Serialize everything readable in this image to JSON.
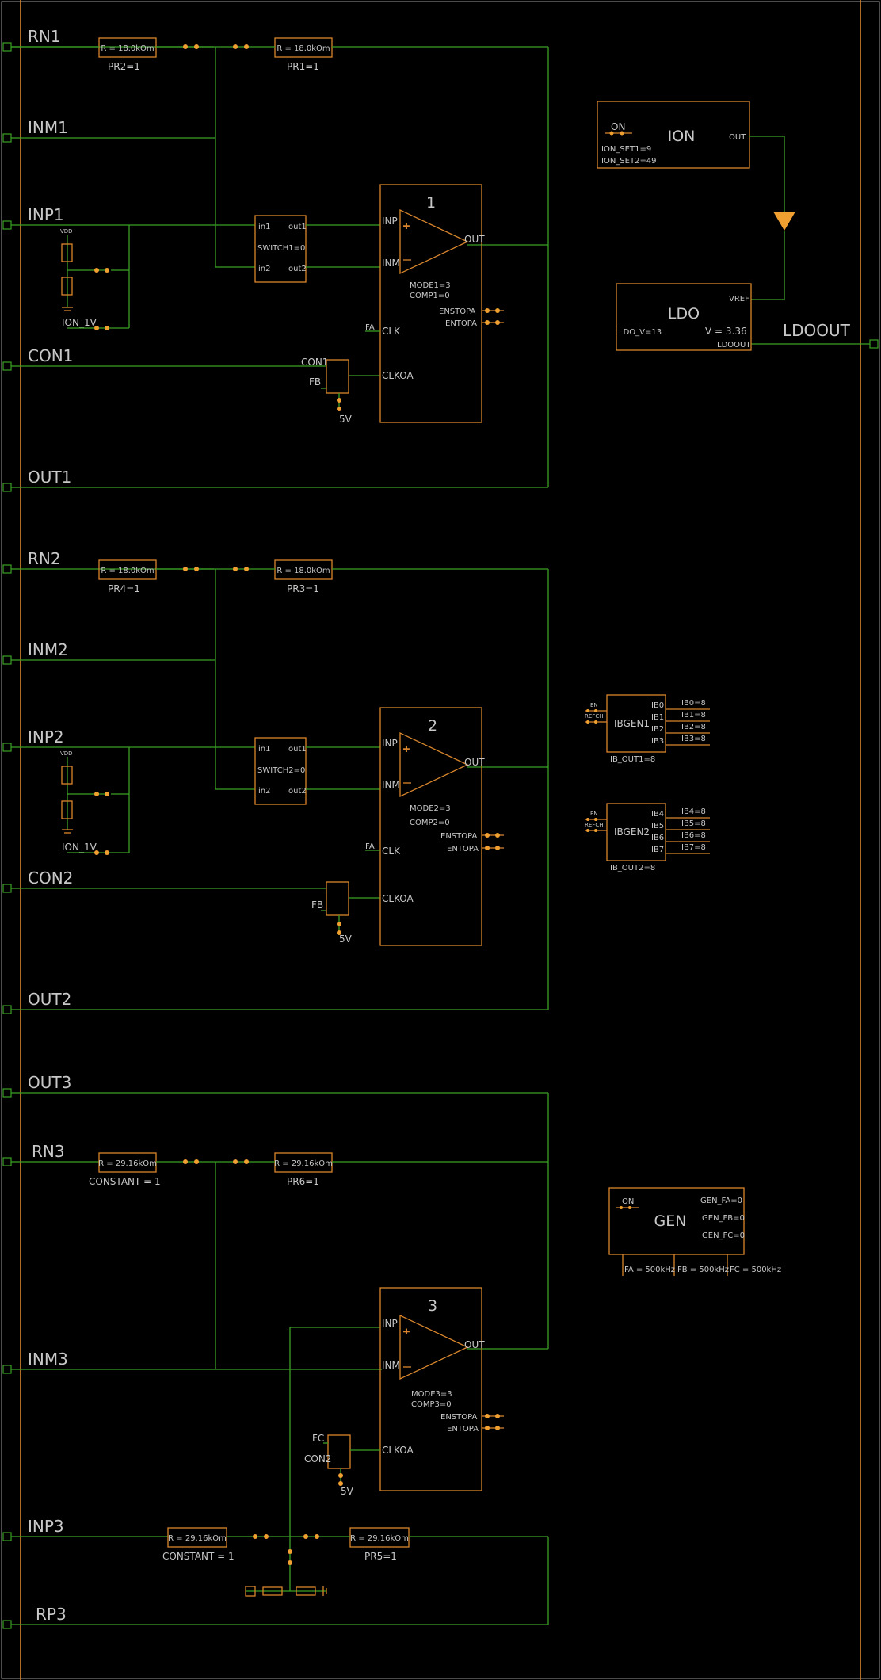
{
  "ports": {
    "rn1": "RN1",
    "inm1": "INM1",
    "inp1": "INP1",
    "con1": "CON1",
    "out1": "OUT1",
    "rn2": "RN2",
    "inm2": "INM2",
    "inp2": "INP2",
    "con2": "CON2",
    "out2": "OUT2",
    "out3": "OUT3",
    "rn3": "RN3",
    "inm3": "INM3",
    "inp3": "INP3",
    "rp3": "RP3",
    "ldoout": "LDOOUT"
  },
  "resistors": {
    "r1a_value": "R = 18.0kOm",
    "r1a_label": "PR2=1",
    "r1b_value": "R = 18.0kOm",
    "r1b_label": "PR1=1",
    "r2a_value": "R = 18.0kOm",
    "r2a_label": "PR4=1",
    "r2b_value": "R = 18.0kOm",
    "r2b_label": "PR3=1",
    "r3a_value": "R = 29.16kOm",
    "r3a_label": "CONSTANT = 1",
    "r3b_value": "R = 29.16kOm",
    "r3b_label": "PR6=1",
    "r4a_value": "R = 29.16kOm",
    "r4a_label": "CONSTANT = 1",
    "r4b_value": "R = 29.16kOm",
    "r4b_label": "PR5=1"
  },
  "amp1": {
    "num": "1",
    "inp": "INP",
    "inm": "INM",
    "out": "OUT",
    "mode": "MODE1=3",
    "comp": "COMP1=0",
    "enstopa": "ENSTOPA",
    "entopa": "ENTOPA",
    "clk": "CLK",
    "clkoa": "CLKOA",
    "fa": "FA"
  },
  "amp2": {
    "num": "2",
    "inp": "INP",
    "inm": "INM",
    "out": "OUT",
    "mode": "MODE2=3",
    "comp": "COMP2=0",
    "enstopa": "ENSTOPA",
    "entopa": "ENTOPA",
    "clk": "CLK",
    "clkoa": "CLKOA",
    "fa": "FA"
  },
  "amp3": {
    "num": "3",
    "inp": "INP",
    "inm": "INM",
    "out": "OUT",
    "mode": "MODE3=3",
    "comp": "COMP3=0",
    "enstopa": "ENSTOPA",
    "entopa": "ENTOPA",
    "clkoa": "CLKOA"
  },
  "switch1": {
    "in1": "in1",
    "in2": "in2",
    "out1": "out1",
    "out2": "out2",
    "label": "SWITCH1=0"
  },
  "switch2": {
    "in1": "in1",
    "in2": "in2",
    "out1": "out1",
    "out2": "out2",
    "label": "SWITCH2=0"
  },
  "divider1": {
    "vdd": "VDD",
    "ion": "ION_1V"
  },
  "divider2": {
    "vdd": "VDD",
    "ion": "ION_1V"
  },
  "mux1": {
    "con": "CON1",
    "fb": "FB",
    "v5": "5V"
  },
  "mux2": {
    "fb": "FB",
    "v5": "5V"
  },
  "mux3": {
    "fc": "FC",
    "con": "CON2",
    "v5": "5V"
  },
  "ion": {
    "title": "ION",
    "on": "ON",
    "set1": "ION_SET1=9",
    "set2": "ION_SET2=49",
    "out": "OUT"
  },
  "ldo": {
    "title": "LDO",
    "vref": "VREF",
    "ldo_v": "LDO_V=13",
    "v": "V = 3.36",
    "ldoout": "LDOOUT"
  },
  "ibgen1": {
    "title": "IBGEN1",
    "en": "EN",
    "refch": "REFCH",
    "sub": "IB_OUT1=8",
    "pins": [
      "IB0",
      "IB1",
      "IB2",
      "IB3"
    ],
    "vals": [
      "IB0=8",
      "IB1=8",
      "IB2=8",
      "IB3=8"
    ]
  },
  "ibgen2": {
    "title": "IBGEN2",
    "en": "EN",
    "refch": "REFCH",
    "sub": "IB_OUT2=8",
    "pins": [
      "IB4",
      "IB5",
      "IB6",
      "IB7"
    ],
    "vals": [
      "IB4=8",
      "IB5=8",
      "IB6=8",
      "IB7=8"
    ]
  },
  "gen": {
    "title": "GEN",
    "on": "ON",
    "fa": "GEN_FA=0",
    "fb": "GEN_FB=0",
    "fc": "GEN_FC=0",
    "fa_freq": "FA = 500kHz",
    "fb_freq": "FB = 500kHz",
    "fc_freq": "FC = 500kHz"
  },
  "colors": {
    "wire": "#3aa024",
    "block": "#d9862c",
    "text": "#c8c8c8",
    "background": "#000000"
  }
}
